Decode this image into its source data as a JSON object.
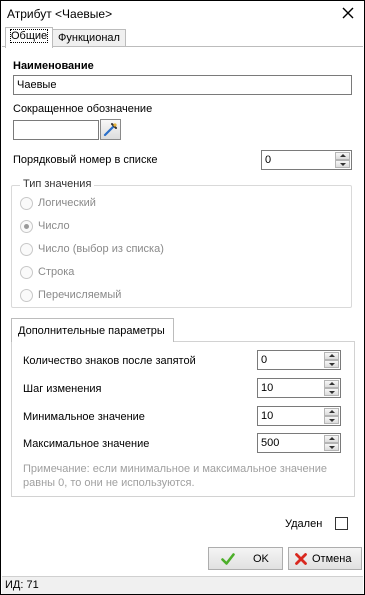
{
  "window": {
    "title": "Атрибут <Чаевые>"
  },
  "tabs": [
    {
      "label": "Общие",
      "active": true
    },
    {
      "label": "Функционал",
      "active": false
    }
  ],
  "general": {
    "name_label": "Наименование",
    "name_value": "Чаевые",
    "short_label": "Сокращенное обозначение",
    "short_value": "",
    "order_label": "Порядковый номер в списке",
    "order_value": "0"
  },
  "value_type": {
    "title": "Тип значения",
    "options": [
      {
        "label": "Логический",
        "checked": false
      },
      {
        "label": "Число",
        "checked": true
      },
      {
        "label": "Число (выбор из списка)",
        "checked": false
      },
      {
        "label": "Строка",
        "checked": false
      },
      {
        "label": "Перечисляемый",
        "checked": false
      }
    ]
  },
  "params": {
    "tab_label": "Дополнительные параметры",
    "decimals_label": "Количество знаков после запятой",
    "decimals_value": "0",
    "step_label": "Шаг изменения",
    "step_value": "10",
    "min_label": "Минимальное значение",
    "min_value": "10",
    "max_label": "Максимальное значение",
    "max_value": "500",
    "note": "Примечание: если минимальное и максимальное значение равны 0, то они не используются."
  },
  "deleted": {
    "label": "Удален",
    "checked": false
  },
  "buttons": {
    "ok": "OK",
    "cancel": "Отмена"
  },
  "status": {
    "id_text": "ИД: 71"
  },
  "colors": {
    "ok_check": "#4caf2a",
    "cancel_x": "#d9281f"
  }
}
